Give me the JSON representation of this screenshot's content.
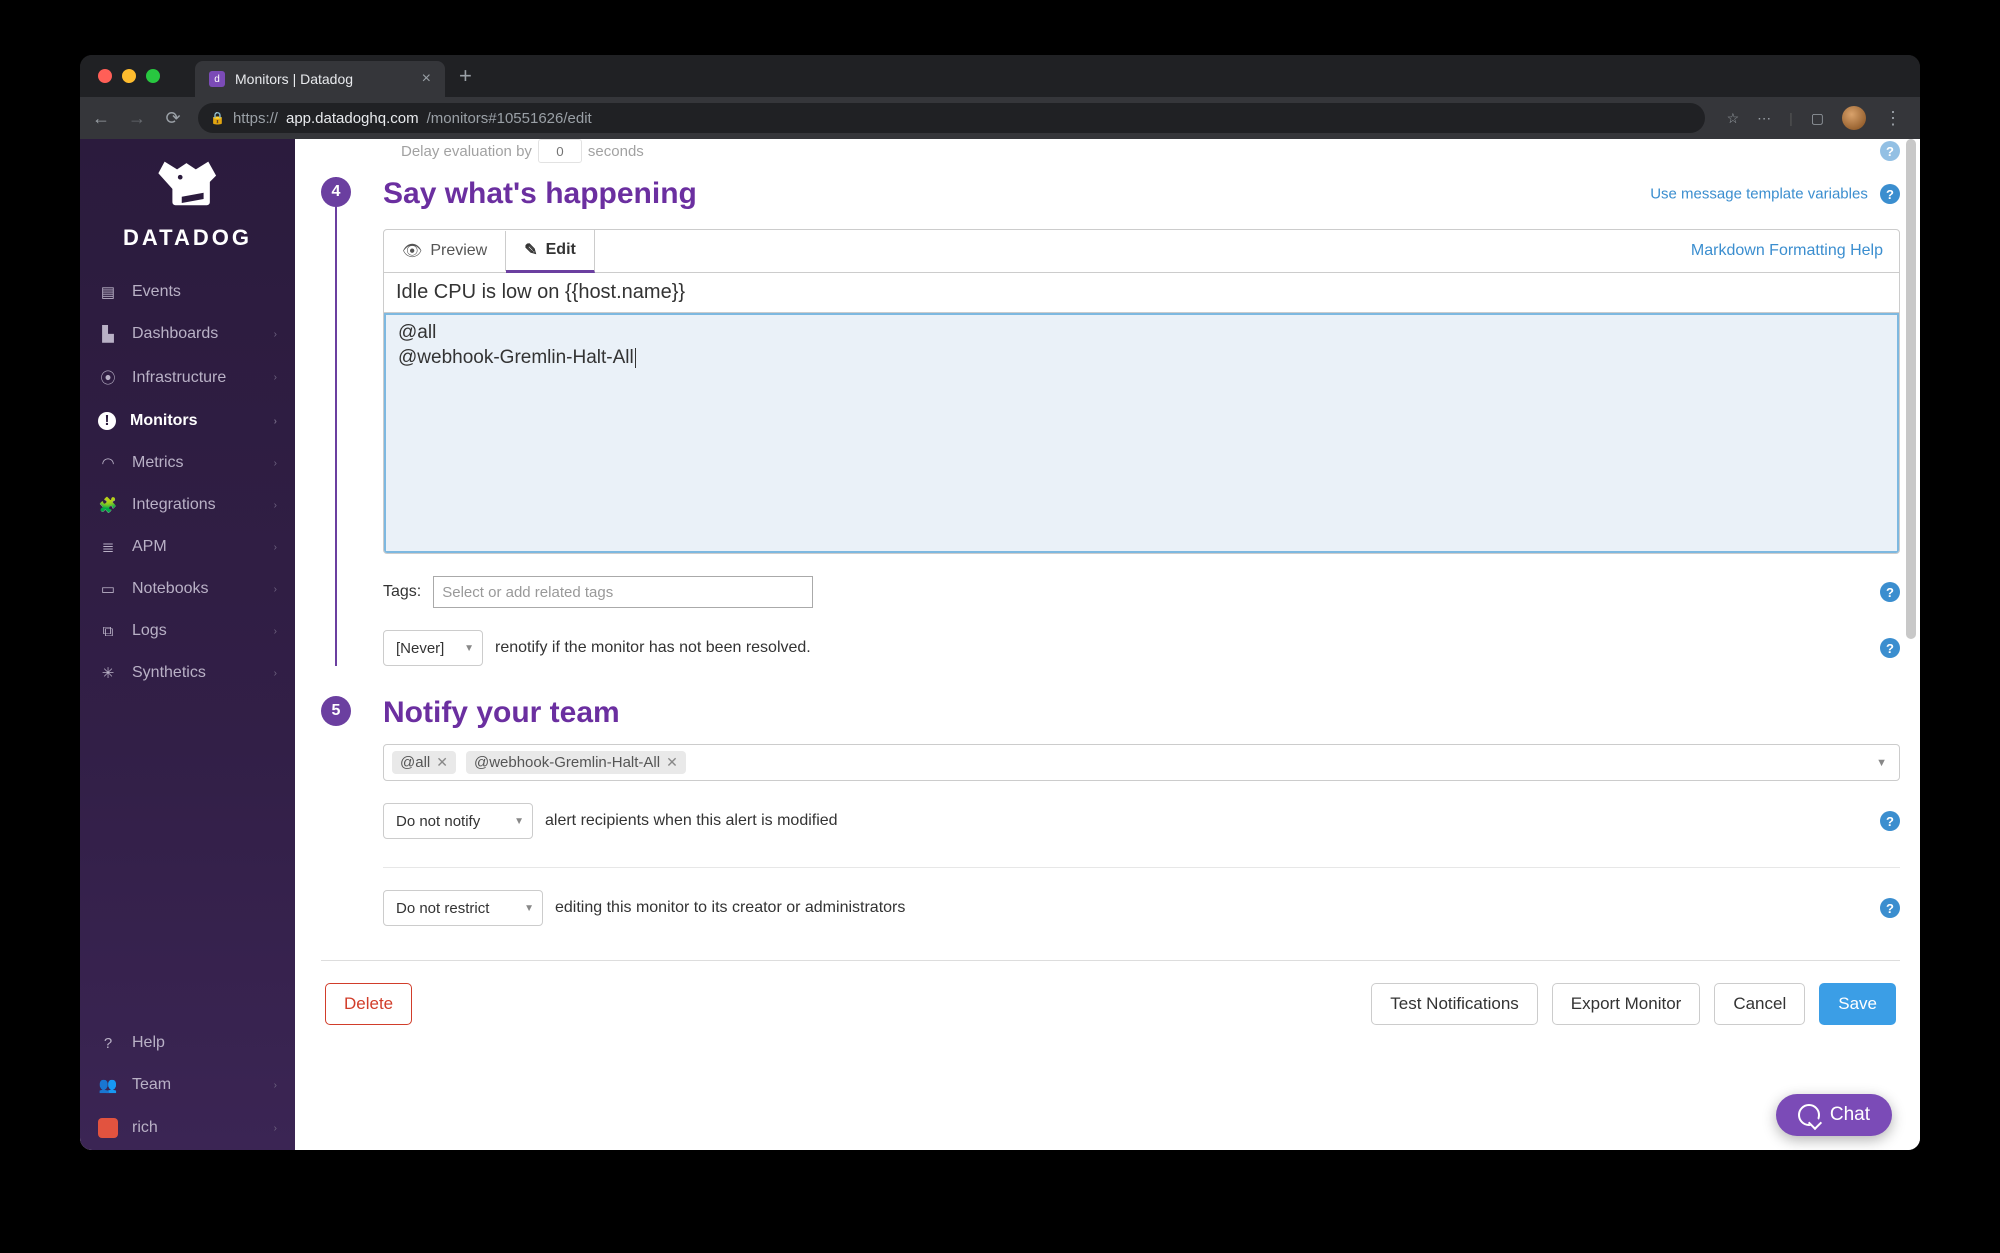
{
  "browser": {
    "tab_title": "Monitors | Datadog",
    "url_full": "https://app.datadoghq.com/monitors#10551626/edit",
    "url_host": "app.datadoghq.com",
    "url_path": "/monitors#10551626/edit"
  },
  "brand": "DATADOG",
  "sidebar": {
    "items": [
      {
        "label": "Events",
        "icon": "▤"
      },
      {
        "label": "Dashboards",
        "icon": "▁▃"
      },
      {
        "label": "Infrastructure",
        "icon": "⦿"
      },
      {
        "label": "Monitors",
        "icon": "!",
        "active": true
      },
      {
        "label": "Metrics",
        "icon": "◡"
      },
      {
        "label": "Integrations",
        "icon": "🧩"
      },
      {
        "label": "APM",
        "icon": "≣"
      },
      {
        "label": "Notebooks",
        "icon": "📓"
      },
      {
        "label": "Logs",
        "icon": "⧉"
      },
      {
        "label": "Synthetics",
        "icon": "✳"
      }
    ],
    "help": "Help",
    "team": "Team",
    "user": "rich"
  },
  "top_fragment": {
    "prefix": "Delay evaluation by",
    "value": "0",
    "suffix": "seconds"
  },
  "section4": {
    "num": "4",
    "title": "Say what's happening",
    "template_link": "Use message template variables",
    "tabs": {
      "preview": "Preview",
      "edit": "Edit"
    },
    "md_help": "Markdown Formatting Help",
    "subject": "Idle CPU is low on {{host.name}}",
    "body_line1": "@all",
    "body_line2": "@webhook-Gremlin-Halt-All",
    "tags_label": "Tags:",
    "tags_placeholder": "Select or add related tags",
    "renotify_select": "[Never]",
    "renotify_text": "renotify if the monitor has not been resolved."
  },
  "section5": {
    "num": "5",
    "title": "Notify your team",
    "recipients": [
      "@all",
      "@webhook-Gremlin-Halt-All"
    ],
    "modify_select": "Do not notify",
    "modify_text": "alert recipients when this alert is modified",
    "restrict_select": "Do not restrict",
    "restrict_text": "editing this monitor to its creator or administrators"
  },
  "footer": {
    "delete": "Delete",
    "test": "Test Notifications",
    "export": "Export Monitor",
    "cancel": "Cancel",
    "save": "Save"
  },
  "chat": "Chat"
}
